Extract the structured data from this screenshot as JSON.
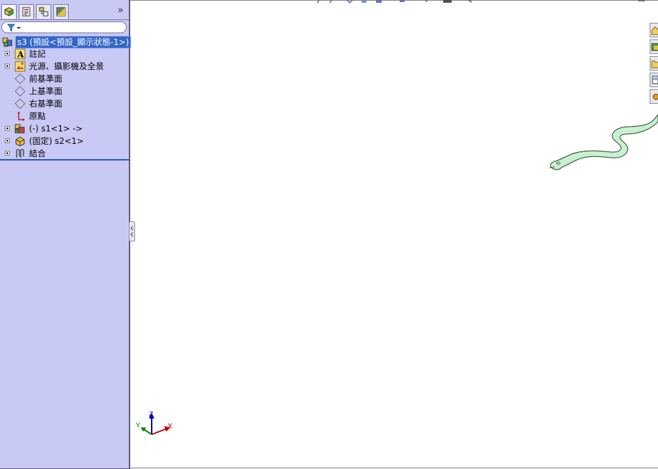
{
  "panel": {
    "tabs": [
      {
        "name": "featuremanager",
        "icon": "feature-tree-icon"
      },
      {
        "name": "propertymanager",
        "icon": "property-manager-icon"
      },
      {
        "name": "configurationmanager",
        "icon": "configuration-manager-icon"
      },
      {
        "name": "displaymanager",
        "icon": "display-manager-icon"
      }
    ],
    "expand_label": "»",
    "filter_icon": "filter-icon"
  },
  "tree": {
    "root": {
      "label": "s3  (預設<預設_顯示狀態-1>)",
      "icon": "assembly-icon",
      "selected": true
    },
    "items": [
      {
        "label": "註記",
        "icon": "annotations-icon",
        "expandable": true
      },
      {
        "label": "光源、攝影機及全景",
        "icon": "lights-cameras-icon",
        "expandable": true
      },
      {
        "label": "前基準面",
        "icon": "plane-icon",
        "expandable": false
      },
      {
        "label": "上基準面",
        "icon": "plane-icon",
        "expandable": false
      },
      {
        "label": "右基準面",
        "icon": "plane-icon",
        "expandable": false
      },
      {
        "label": "原點",
        "icon": "origin-icon",
        "expandable": false
      },
      {
        "label": "(-) s1<1> ->",
        "icon": "part-icon",
        "expandable": true
      },
      {
        "label": "(固定) s2<1>",
        "icon": "part-icon",
        "expandable": true
      },
      {
        "label": "結合",
        "icon": "mates-icon",
        "expandable": true
      }
    ]
  },
  "triad": {
    "x": "X",
    "y": "Y",
    "z": "Z"
  },
  "colors": {
    "panel_bg": "#c9c9f5",
    "selection": "#3166c9",
    "model_fill": "#c8f2cf",
    "axis_x": "#c00000",
    "axis_y": "#008000",
    "axis_z": "#0000c0"
  }
}
